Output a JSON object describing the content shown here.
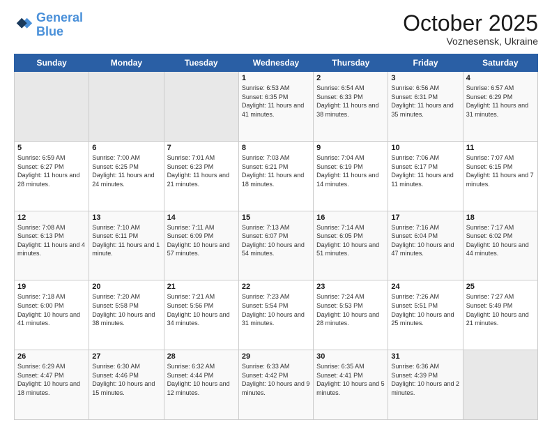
{
  "header": {
    "logo_line1": "General",
    "logo_line2": "Blue",
    "month": "October 2025",
    "location": "Voznesensk, Ukraine"
  },
  "weekdays": [
    "Sunday",
    "Monday",
    "Tuesday",
    "Wednesday",
    "Thursday",
    "Friday",
    "Saturday"
  ],
  "weeks": [
    [
      {
        "day": "",
        "empty": true
      },
      {
        "day": "",
        "empty": true
      },
      {
        "day": "",
        "empty": true
      },
      {
        "day": "1",
        "sunrise": "6:53 AM",
        "sunset": "6:35 PM",
        "daylight": "11 hours and 41 minutes."
      },
      {
        "day": "2",
        "sunrise": "6:54 AM",
        "sunset": "6:33 PM",
        "daylight": "11 hours and 38 minutes."
      },
      {
        "day": "3",
        "sunrise": "6:56 AM",
        "sunset": "6:31 PM",
        "daylight": "11 hours and 35 minutes."
      },
      {
        "day": "4",
        "sunrise": "6:57 AM",
        "sunset": "6:29 PM",
        "daylight": "11 hours and 31 minutes."
      }
    ],
    [
      {
        "day": "5",
        "sunrise": "6:59 AM",
        "sunset": "6:27 PM",
        "daylight": "11 hours and 28 minutes."
      },
      {
        "day": "6",
        "sunrise": "7:00 AM",
        "sunset": "6:25 PM",
        "daylight": "11 hours and 24 minutes."
      },
      {
        "day": "7",
        "sunrise": "7:01 AM",
        "sunset": "6:23 PM",
        "daylight": "11 hours and 21 minutes."
      },
      {
        "day": "8",
        "sunrise": "7:03 AM",
        "sunset": "6:21 PM",
        "daylight": "11 hours and 18 minutes."
      },
      {
        "day": "9",
        "sunrise": "7:04 AM",
        "sunset": "6:19 PM",
        "daylight": "11 hours and 14 minutes."
      },
      {
        "day": "10",
        "sunrise": "7:06 AM",
        "sunset": "6:17 PM",
        "daylight": "11 hours and 11 minutes."
      },
      {
        "day": "11",
        "sunrise": "7:07 AM",
        "sunset": "6:15 PM",
        "daylight": "11 hours and 7 minutes."
      }
    ],
    [
      {
        "day": "12",
        "sunrise": "7:08 AM",
        "sunset": "6:13 PM",
        "daylight": "11 hours and 4 minutes."
      },
      {
        "day": "13",
        "sunrise": "7:10 AM",
        "sunset": "6:11 PM",
        "daylight": "11 hours and 1 minute."
      },
      {
        "day": "14",
        "sunrise": "7:11 AM",
        "sunset": "6:09 PM",
        "daylight": "10 hours and 57 minutes."
      },
      {
        "day": "15",
        "sunrise": "7:13 AM",
        "sunset": "6:07 PM",
        "daylight": "10 hours and 54 minutes."
      },
      {
        "day": "16",
        "sunrise": "7:14 AM",
        "sunset": "6:05 PM",
        "daylight": "10 hours and 51 minutes."
      },
      {
        "day": "17",
        "sunrise": "7:16 AM",
        "sunset": "6:04 PM",
        "daylight": "10 hours and 47 minutes."
      },
      {
        "day": "18",
        "sunrise": "7:17 AM",
        "sunset": "6:02 PM",
        "daylight": "10 hours and 44 minutes."
      }
    ],
    [
      {
        "day": "19",
        "sunrise": "7:18 AM",
        "sunset": "6:00 PM",
        "daylight": "10 hours and 41 minutes."
      },
      {
        "day": "20",
        "sunrise": "7:20 AM",
        "sunset": "5:58 PM",
        "daylight": "10 hours and 38 minutes."
      },
      {
        "day": "21",
        "sunrise": "7:21 AM",
        "sunset": "5:56 PM",
        "daylight": "10 hours and 34 minutes."
      },
      {
        "day": "22",
        "sunrise": "7:23 AM",
        "sunset": "5:54 PM",
        "daylight": "10 hours and 31 minutes."
      },
      {
        "day": "23",
        "sunrise": "7:24 AM",
        "sunset": "5:53 PM",
        "daylight": "10 hours and 28 minutes."
      },
      {
        "day": "24",
        "sunrise": "7:26 AM",
        "sunset": "5:51 PM",
        "daylight": "10 hours and 25 minutes."
      },
      {
        "day": "25",
        "sunrise": "7:27 AM",
        "sunset": "5:49 PM",
        "daylight": "10 hours and 21 minutes."
      }
    ],
    [
      {
        "day": "26",
        "sunrise": "6:29 AM",
        "sunset": "4:47 PM",
        "daylight": "10 hours and 18 minutes."
      },
      {
        "day": "27",
        "sunrise": "6:30 AM",
        "sunset": "4:46 PM",
        "daylight": "10 hours and 15 minutes."
      },
      {
        "day": "28",
        "sunrise": "6:32 AM",
        "sunset": "4:44 PM",
        "daylight": "10 hours and 12 minutes."
      },
      {
        "day": "29",
        "sunrise": "6:33 AM",
        "sunset": "4:42 PM",
        "daylight": "10 hours and 9 minutes."
      },
      {
        "day": "30",
        "sunrise": "6:35 AM",
        "sunset": "4:41 PM",
        "daylight": "10 hours and 5 minutes."
      },
      {
        "day": "31",
        "sunrise": "6:36 AM",
        "sunset": "4:39 PM",
        "daylight": "10 hours and 2 minutes."
      },
      {
        "day": "",
        "empty": true
      }
    ]
  ]
}
